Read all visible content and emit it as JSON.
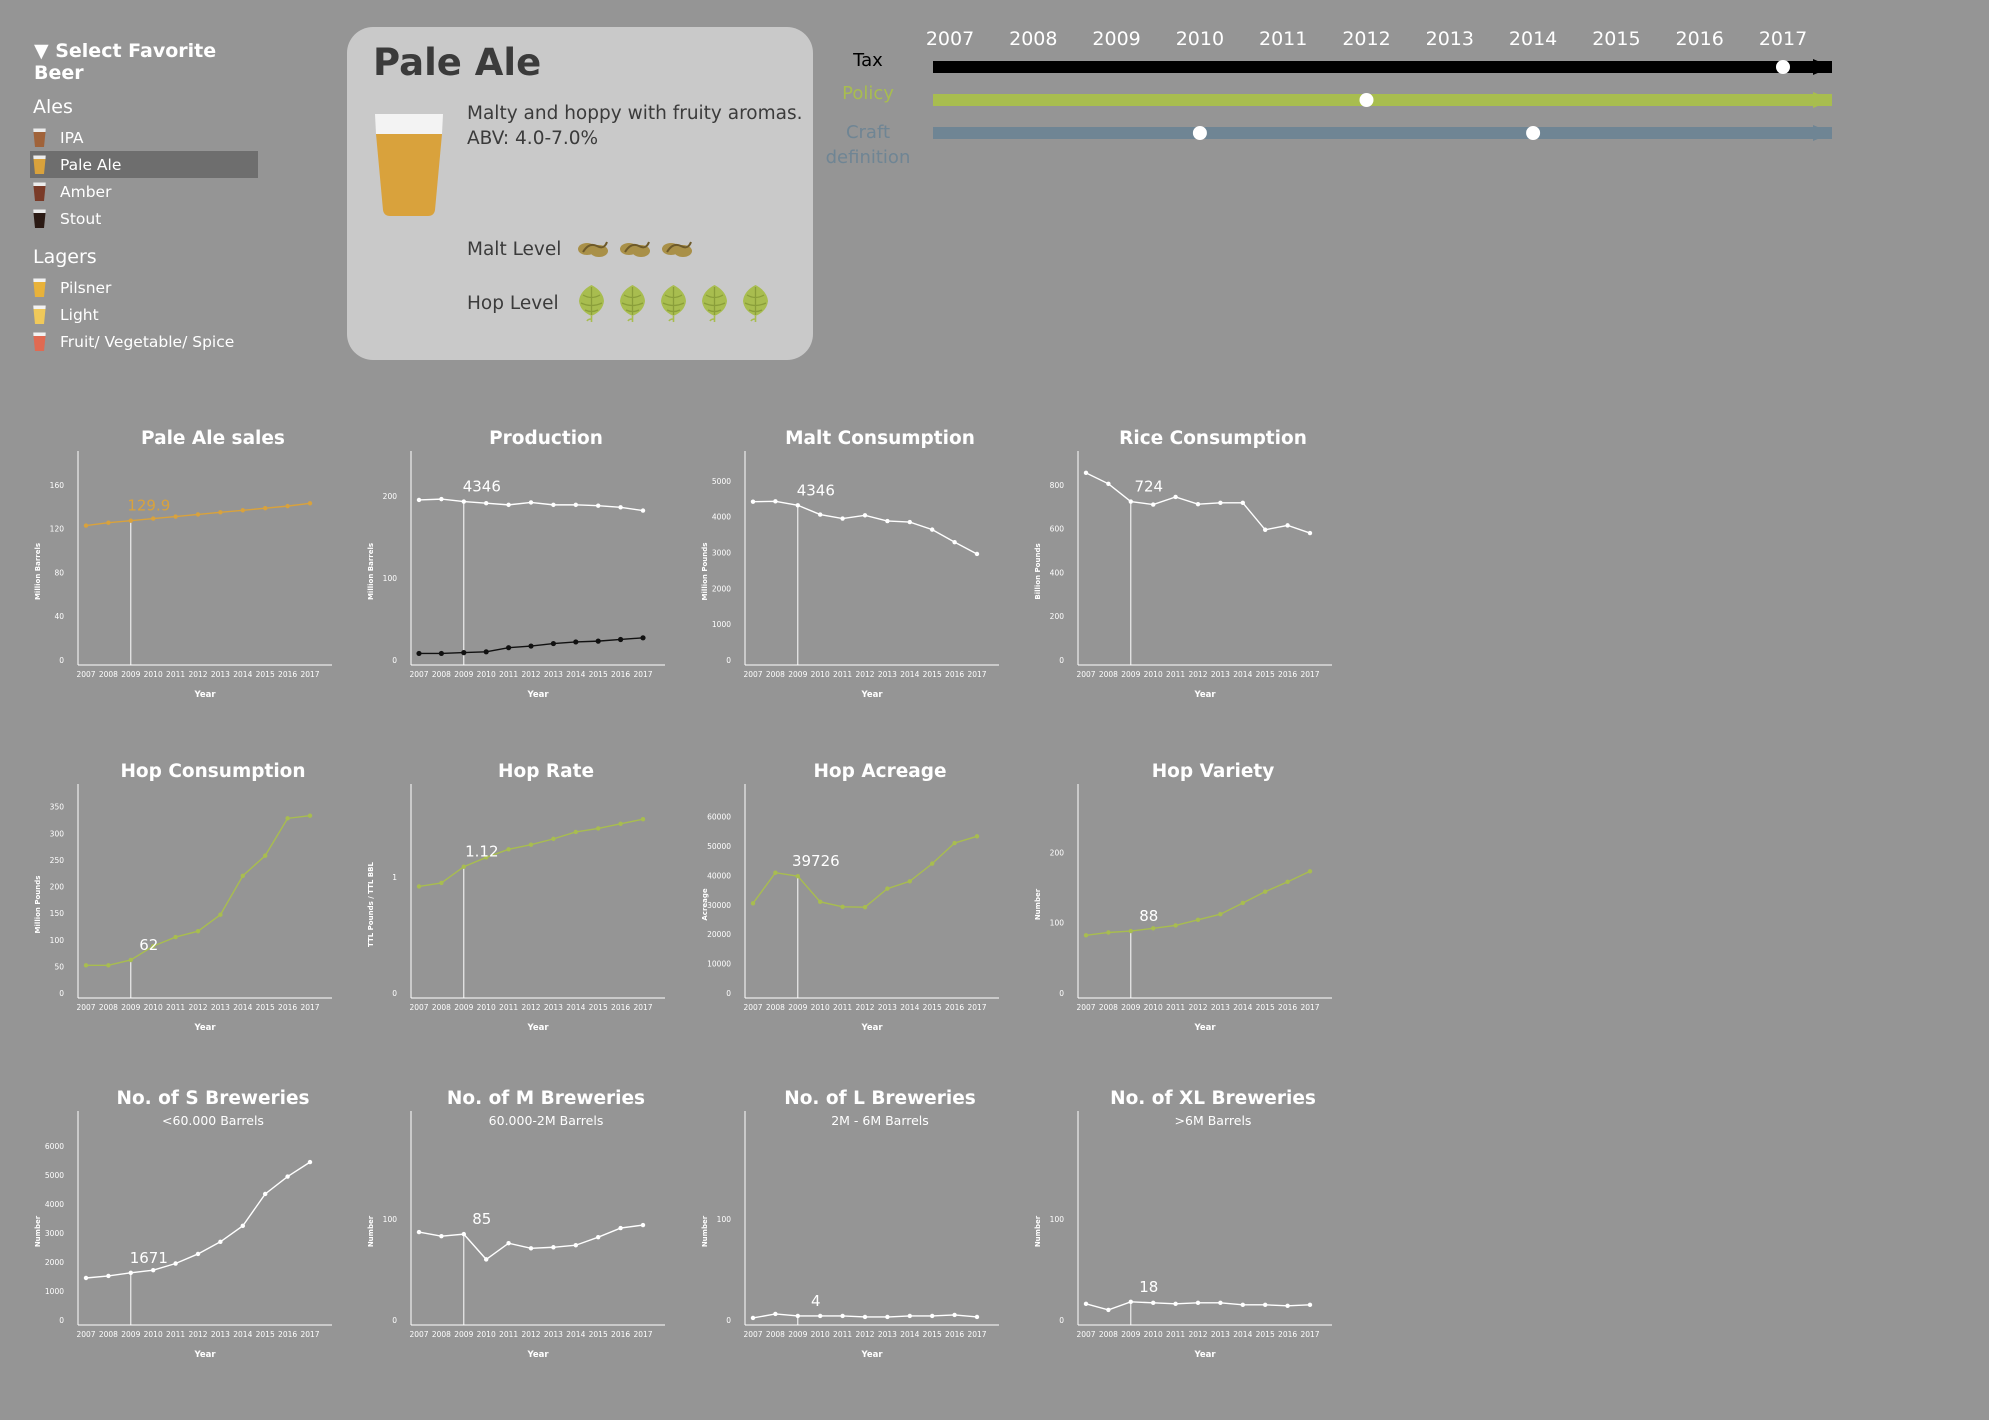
{
  "sidebar": {
    "title": "▼ Select Favorite Beer",
    "groups": [
      {
        "label": "Ales",
        "items": [
          {
            "label": "IPA",
            "color": "#a0633a",
            "foam": "#ececec",
            "selected": false
          },
          {
            "label": "Pale Ale",
            "color": "#d9a23c",
            "foam": "#ececec",
            "selected": true
          },
          {
            "label": "Amber",
            "color": "#7a3b28",
            "foam": "#ececec",
            "selected": false
          },
          {
            "label": "Stout",
            "color": "#2b1a14",
            "foam": "#ececec",
            "selected": false
          }
        ]
      },
      {
        "label": "Lagers",
        "items": [
          {
            "label": "Pilsner",
            "color": "#e8b23a",
            "foam": "#f2f2f2",
            "selected": false
          },
          {
            "label": "Light",
            "color": "#f0c95a",
            "foam": "#f2f2f2",
            "selected": false
          },
          {
            "label": "Fruit/ Vegetable/ Spice",
            "color": "#e06a52",
            "foam": "#f2f2f2",
            "selected": false
          }
        ]
      }
    ]
  },
  "card": {
    "name": "Pale Ale",
    "description": "Malty and hoppy with fruity aromas.",
    "abv": "ABV: 4.0-7.0%",
    "malt_label": "Malt Level",
    "malt_level": 3,
    "hop_label": "Hop Level",
    "hop_level": 5,
    "beer_color": "#d9a23c",
    "malt_color": "#a99048",
    "hop_color": "#a8bd4f"
  },
  "timeline": {
    "years": [
      "2007",
      "2008",
      "2009",
      "2010",
      "2011",
      "2012",
      "2013",
      "2014",
      "2015",
      "2016",
      "2017"
    ],
    "tracks": [
      {
        "label": "Tax",
        "color": "#000000",
        "label_color": "#000000",
        "events": [
          "2017"
        ]
      },
      {
        "label": "Policy",
        "color": "#a8bd4f",
        "label_color": "#a8bd4f",
        "events": [
          "2012"
        ]
      },
      {
        "label": "Craft definition",
        "color": "#6f8594",
        "label_color": "#6f8594",
        "events": [
          "2010",
          "2014"
        ]
      }
    ]
  },
  "colors": {
    "white": "#ffffff",
    "gold": "#d9a23c",
    "green": "#a8bd4f",
    "black": "#111111"
  },
  "chart_data": [
    {
      "type": "line",
      "title": "Pale Ale sales",
      "subtitle": "",
      "xlabel": "Year",
      "ylabel": "Million Barrels",
      "x": [
        2007,
        2008,
        2009,
        2010,
        2011,
        2012,
        2013,
        2014,
        2015,
        2016,
        2017
      ],
      "ylim": [
        0,
        180
      ],
      "yticks": [
        0,
        40,
        80,
        120,
        160
      ],
      "highlight_year": 2009,
      "highlight_label": "129.9",
      "label_color": "#d9a23c",
      "series": [
        {
          "color": "#d9a23c",
          "values": [
            122.8,
            125.5,
            127.3,
            129.2,
            131.1,
            133.0,
            134.9,
            136.8,
            138.7,
            140.6,
            143.2
          ]
        }
      ]
    },
    {
      "type": "line",
      "title": "Production",
      "subtitle": "",
      "xlabel": "Year",
      "ylabel": "Million Barrels",
      "x": [
        2007,
        2008,
        2009,
        2010,
        2011,
        2012,
        2013,
        2014,
        2015,
        2016,
        2017
      ],
      "ylim": [
        0,
        240
      ],
      "yticks": [
        0,
        100,
        200
      ],
      "highlight_year": 2009,
      "highlight_label": "4346",
      "label_color": "#ffffff",
      "series": [
        {
          "color": "#ffffff",
          "values": [
            195,
            196,
            193,
            191,
            189,
            192,
            189,
            189,
            188,
            186,
            182
          ]
        },
        {
          "color": "#111111",
          "values": [
            8,
            8,
            9,
            10,
            15,
            17,
            20,
            22,
            23,
            25,
            27
          ]
        }
      ]
    },
    {
      "type": "line",
      "title": "Malt Consumption",
      "subtitle": "",
      "xlabel": "Year",
      "ylabel": "Million Pounds",
      "x": [
        2007,
        2008,
        2009,
        2010,
        2011,
        2012,
        2013,
        2014,
        2015,
        2016,
        2017
      ],
      "ylim": [
        0,
        5500
      ],
      "yticks": [
        0,
        1000,
        2000,
        3000,
        4000,
        5000
      ],
      "highlight_year": 2009,
      "highlight_label": "4346",
      "label_color": "#ffffff",
      "series": [
        {
          "color": "#ffffff",
          "values": [
            4420,
            4430,
            4320,
            4060,
            3950,
            4040,
            3880,
            3850,
            3640,
            3290,
            2960
          ]
        }
      ]
    },
    {
      "type": "line",
      "title": "Rice Consumption",
      "subtitle": "",
      "xlabel": "Year",
      "ylabel": "Billion Pounds",
      "x": [
        2007,
        2008,
        2009,
        2010,
        2011,
        2012,
        2013,
        2014,
        2015,
        2016,
        2017
      ],
      "ylim": [
        0,
        900
      ],
      "yticks": [
        0,
        200,
        400,
        600,
        800
      ],
      "highlight_year": 2009,
      "highlight_label": "724",
      "label_color": "#ffffff",
      "series": [
        {
          "color": "#ffffff",
          "values": [
            855,
            805,
            724,
            710,
            745,
            712,
            718,
            718,
            595,
            615,
            580
          ]
        }
      ]
    },
    {
      "type": "line",
      "title": "Hop Consumption",
      "subtitle": "",
      "xlabel": "Year",
      "ylabel": "Million Pounds",
      "x": [
        2007,
        2008,
        2009,
        2010,
        2011,
        2012,
        2013,
        2014,
        2015,
        2016,
        2017
      ],
      "ylim": [
        0,
        370
      ],
      "yticks": [
        0,
        50,
        100,
        150,
        200,
        250,
        300,
        350
      ],
      "highlight_year": 2009,
      "highlight_label": "62",
      "label_color": "#ffffff",
      "series": [
        {
          "color": "#a8bd4f",
          "values": [
            52,
            52,
            62,
            88,
            105,
            116,
            147,
            220,
            258,
            328,
            333
          ]
        }
      ]
    },
    {
      "type": "line",
      "title": "Hop Rate",
      "subtitle": "",
      "xlabel": "Year",
      "ylabel": "TTL Pounds / TTL BBL",
      "x": [
        2007,
        2008,
        2009,
        2010,
        2011,
        2012,
        2013,
        2014,
        2015,
        2016,
        2017
      ],
      "ylim": [
        0,
        1.7
      ],
      "yticks": [
        0,
        1
      ],
      "highlight_year": 2009,
      "highlight_label": "1.12",
      "label_color": "#ffffff",
      "series": [
        {
          "color": "#a8bd4f",
          "values": [
            0.92,
            0.95,
            1.09,
            1.17,
            1.24,
            1.28,
            1.33,
            1.39,
            1.42,
            1.46,
            1.5
          ]
        }
      ]
    },
    {
      "type": "line",
      "title": "Hop Acreage",
      "subtitle": "",
      "xlabel": "Year",
      "ylabel": "Acreage",
      "x": [
        2007,
        2008,
        2009,
        2010,
        2011,
        2012,
        2013,
        2014,
        2015,
        2016,
        2017
      ],
      "ylim": [
        0,
        67000
      ],
      "yticks": [
        0,
        10000,
        20000,
        30000,
        40000,
        50000,
        60000
      ],
      "highlight_year": 2009,
      "highlight_label": "39726",
      "label_color": "#ffffff",
      "series": [
        {
          "color": "#a8bd4f",
          "values": [
            30500,
            40900,
            39726,
            31000,
            29300,
            29200,
            35500,
            38000,
            44000,
            51000,
            53300
          ]
        }
      ]
    },
    {
      "type": "line",
      "title": "Hop Variety",
      "subtitle": "",
      "xlabel": "Year",
      "ylabel": "Number",
      "x": [
        2007,
        2008,
        2009,
        2010,
        2011,
        2012,
        2013,
        2014,
        2015,
        2016,
        2017
      ],
      "ylim": [
        0,
        280
      ],
      "yticks": [
        0,
        100,
        200
      ],
      "highlight_year": 2009,
      "highlight_label": "88",
      "label_color": "#ffffff",
      "series": [
        {
          "color": "#a8bd4f",
          "values": [
            82,
            86,
            88,
            92,
            96,
            104,
            112,
            128,
            144,
            158,
            173
          ]
        }
      ]
    },
    {
      "type": "line",
      "title": "No. of S Breweries",
      "subtitle": "<60.000 Barrels",
      "xlabel": "Year",
      "ylabel": "Number",
      "x": [
        2007,
        2008,
        2009,
        2010,
        2011,
        2012,
        2013,
        2014,
        2015,
        2016,
        2017
      ],
      "ylim": [
        0,
        6800
      ],
      "yticks": [
        0,
        1000,
        2000,
        3000,
        4000,
        5000,
        6000
      ],
      "highlight_year": 2009,
      "highlight_label": "1671",
      "label_color": "#ffffff",
      "series": [
        {
          "color": "#ffffff",
          "values": [
            1450,
            1520,
            1630,
            1720,
            1950,
            2280,
            2700,
            3250,
            4350,
            4950,
            5450
          ]
        }
      ]
    },
    {
      "type": "line",
      "title": "No. of M Breweries",
      "subtitle": "60.000-2M Barrels",
      "xlabel": "Year",
      "ylabel": "Number",
      "x": [
        2007,
        2008,
        2009,
        2010,
        2011,
        2012,
        2013,
        2014,
        2015,
        2016,
        2017
      ],
      "ylim": [
        0,
        195
      ],
      "yticks": [
        0,
        100
      ],
      "highlight_year": 2009,
      "highlight_label": "85",
      "label_color": "#ffffff",
      "series": [
        {
          "color": "#ffffff",
          "values": [
            87,
            83,
            85,
            60,
            76,
            71,
            72,
            74,
            82,
            91,
            94
          ]
        }
      ]
    },
    {
      "type": "line",
      "title": "No. of L Breweries",
      "subtitle": "2M - 6M Barrels",
      "xlabel": "Year",
      "ylabel": "Number",
      "x": [
        2007,
        2008,
        2009,
        2010,
        2011,
        2012,
        2013,
        2014,
        2015,
        2016,
        2017
      ],
      "ylim": [
        0,
        195
      ],
      "yticks": [
        0,
        100
      ],
      "highlight_year": 2009,
      "highlight_label": "4",
      "label_color": "#ffffff",
      "series": [
        {
          "color": "#ffffff",
          "values": [
            2,
            6,
            4,
            4,
            4,
            3,
            3,
            4,
            4,
            5,
            3
          ]
        }
      ]
    },
    {
      "type": "line",
      "title": "No. of XL Breweries",
      "subtitle": ">6M Barrels",
      "xlabel": "Year",
      "ylabel": "Number",
      "x": [
        2007,
        2008,
        2009,
        2010,
        2011,
        2012,
        2013,
        2014,
        2015,
        2016,
        2017
      ],
      "ylim": [
        0,
        195
      ],
      "yticks": [
        0,
        100
      ],
      "highlight_year": 2009,
      "highlight_label": "18",
      "label_color": "#ffffff",
      "series": [
        {
          "color": "#ffffff",
          "values": [
            16,
            10,
            18,
            17,
            16,
            17,
            17,
            15,
            15,
            14,
            15
          ]
        }
      ]
    }
  ]
}
